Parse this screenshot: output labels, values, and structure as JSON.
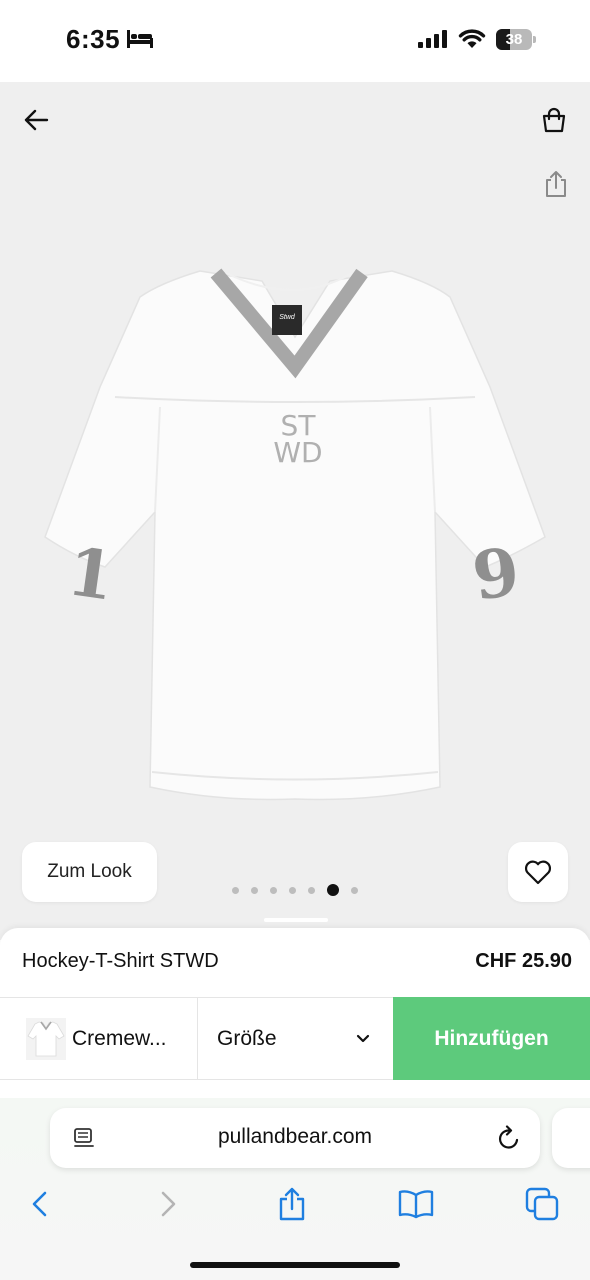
{
  "status_bar": {
    "time": "6:35",
    "battery_level": "38",
    "battery_fraction": 0.38
  },
  "product_view": {
    "look_button_label": "Zum Look",
    "image_count": 7,
    "active_image_index": 5,
    "shirt": {
      "label_text": "Stwd",
      "chest_logo_top": "ST",
      "chest_logo_bottom": "WD",
      "left_sleeve_number": "1",
      "right_sleeve_number": "9",
      "trim_color": "#a7a7a7",
      "shirt_color": "#fbfbfb"
    }
  },
  "product": {
    "name": "Hockey-T-Shirt STWD",
    "price": "CHF 25.90",
    "color_label": "Cremew...",
    "size_label": "Größe",
    "add_button_label": "Hinzufügen"
  },
  "browser": {
    "url": "pullandbear.com"
  },
  "colors": {
    "accent_green": "#5dca7c",
    "browser_blue": "#1f7fe0",
    "image_background": "#efefef"
  }
}
